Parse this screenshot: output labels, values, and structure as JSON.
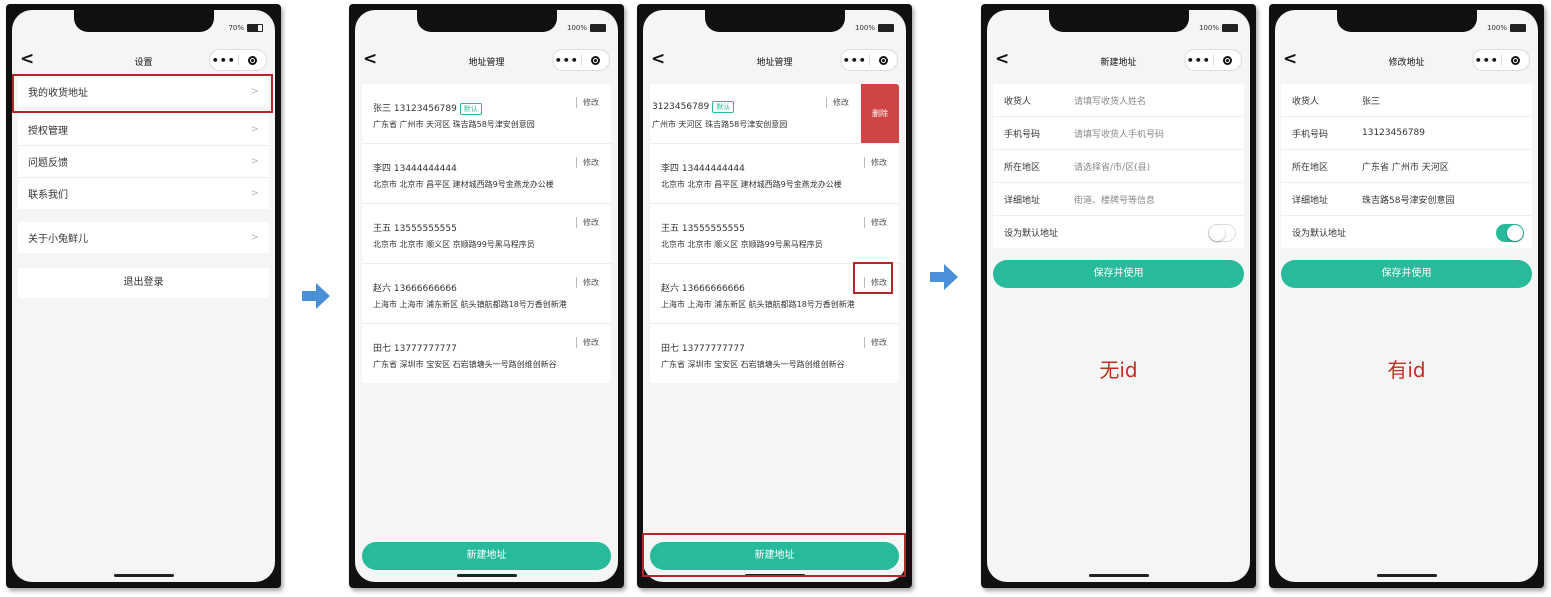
{
  "colors": {
    "accent": "#27ba9b",
    "delete": "#cf4444",
    "highlight": "#b3262a",
    "note": "#c0301f",
    "arrow": "#4a90d9"
  },
  "phone1": {
    "battery": "70%",
    "nav": {
      "back_icon": "chevron-left-icon",
      "title": "设置",
      "more": "•••"
    },
    "menu": [
      "我的收货地址",
      "授权管理",
      "问题反馈",
      "联系我们"
    ],
    "about": "关于小兔鲜儿",
    "chevron": ">",
    "logout": "退出登录"
  },
  "phone2": {
    "battery": "100%",
    "nav": {
      "title": "地址管理",
      "more": "•••"
    },
    "default_badge": "默认",
    "edit_label": "修改",
    "addresses": [
      {
        "name_phone": "张三 13123456789",
        "address": "广东省 广州市 天河区 珠吉路58号津安创意园"
      },
      {
        "name_phone": "李四 13444444444",
        "address": "北京市 北京市 昌平区 建材城西路9号金燕龙办公楼"
      },
      {
        "name_phone": "王五 13555555555",
        "address": "北京市 北京市 顺义区 京顺路99号黑马程序员"
      },
      {
        "name_phone": "赵六 13666666666",
        "address": "上海市 上海市 浦东新区 航头镇航都路18号万香创新港"
      },
      {
        "name_phone": "田七 13777777777",
        "address": "广东省 深圳市 宝安区 石岩镇塘头一号路创维创新谷"
      }
    ],
    "new_button": "新建地址"
  },
  "phone3": {
    "battery": "100%",
    "nav": {
      "title": "地址管理",
      "more": "•••"
    },
    "default_badge": "默认",
    "edit_label": "修改",
    "delete_label": "删除",
    "first_name_phone": "3123456789",
    "first_address": "广州市 天河区 珠吉路58号津安创意园",
    "addresses": [
      {
        "name_phone": "李四 13444444444",
        "address": "北京市 北京市 昌平区 建材城西路9号金燕龙办公楼"
      },
      {
        "name_phone": "王五 13555555555",
        "address": "北京市 北京市 顺义区 京顺路99号黑马程序员"
      },
      {
        "name_phone": "赵六 13666666666",
        "address": "上海市 上海市 浦东新区 航头镇航都路18号万香创新港"
      },
      {
        "name_phone": "田七 13777777777",
        "address": "广东省 深圳市 宝安区 石岩镇塘头一号路创维创新谷"
      }
    ],
    "new_button": "新建地址"
  },
  "phone4": {
    "battery": "100%",
    "nav": {
      "title": "新建地址",
      "more": "•••"
    },
    "fields": [
      {
        "label": "收货人",
        "placeholder": "请填写收货人姓名"
      },
      {
        "label": "手机号码",
        "placeholder": "请填写收货人手机号码"
      },
      {
        "label": "所在地区",
        "placeholder": "请选择省/市/区(县)"
      },
      {
        "label": "详细地址",
        "placeholder": "街道、楼牌号等信息"
      }
    ],
    "default_label": "设为默认地址",
    "save": "保存并使用",
    "note": "无id"
  },
  "phone5": {
    "battery": "100%",
    "nav": {
      "title": "修改地址",
      "more": "•••"
    },
    "fields": [
      {
        "label": "收货人",
        "value": "张三"
      },
      {
        "label": "手机号码",
        "value": "13123456789"
      },
      {
        "label": "所在地区",
        "value": "广东省 广州市 天河区"
      },
      {
        "label": "详细地址",
        "value": "珠吉路58号津安创意园"
      }
    ],
    "default_label": "设为默认地址",
    "save": "保存并使用",
    "note": "有id"
  }
}
